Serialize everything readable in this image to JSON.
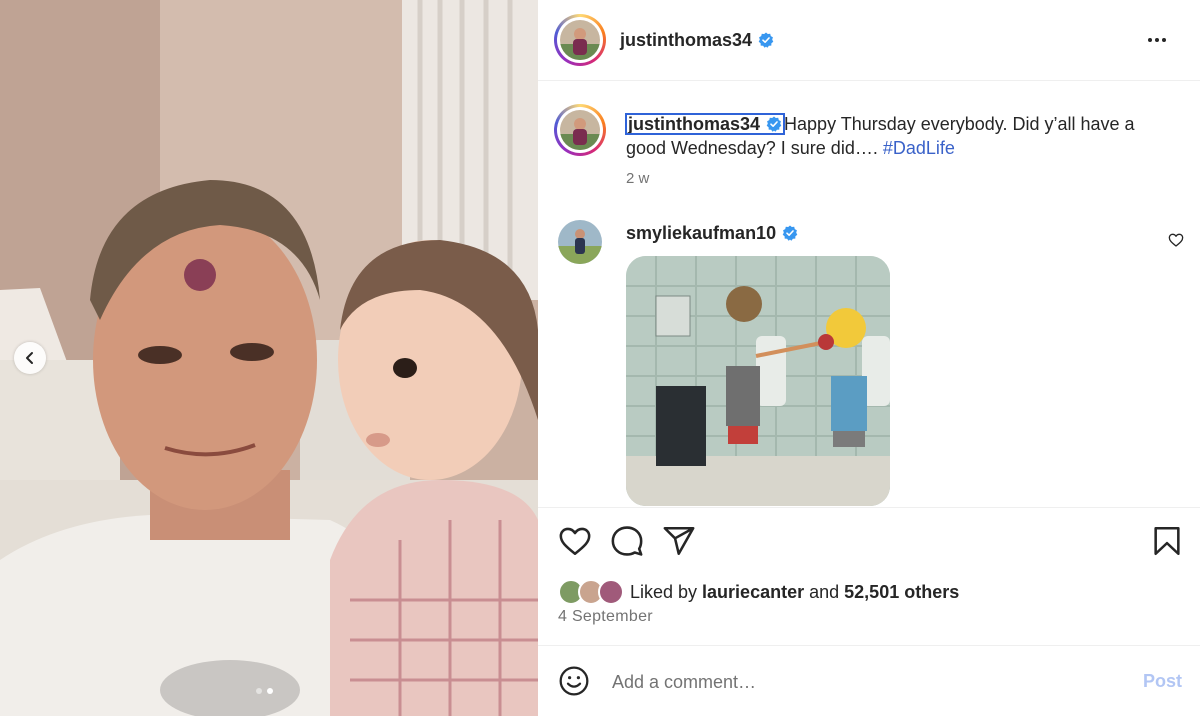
{
  "post": {
    "author": "justinthomas34",
    "caption_text": "Happy Thursday everybody. Did y’all have a good Wednesday? I sure did…. ",
    "hashtag": "#DadLife",
    "caption_age": "2 w",
    "carousel": {
      "total": 2,
      "active": 2
    }
  },
  "comment": {
    "user": "smyliekaufman10"
  },
  "likes": {
    "prefix": "Liked by ",
    "liker": "lauriecanter",
    "middle": " and ",
    "count_text": "52,501 others"
  },
  "date": "4 September",
  "comment_box": {
    "placeholder": "Add a comment…",
    "post_label": "Post"
  },
  "colors": {
    "verified": "#3897f0",
    "link": "#3a62c9",
    "post_disabled": "#b2c6f4",
    "focus_outline": "#2f63d8"
  },
  "icons": {
    "header_more": "more-horizontal-icon",
    "like": "heart-icon",
    "comment": "comment-bubble-icon",
    "share": "paper-plane-icon",
    "save": "bookmark-icon",
    "emoji": "smiley-icon",
    "prev": "chevron-left-icon"
  }
}
